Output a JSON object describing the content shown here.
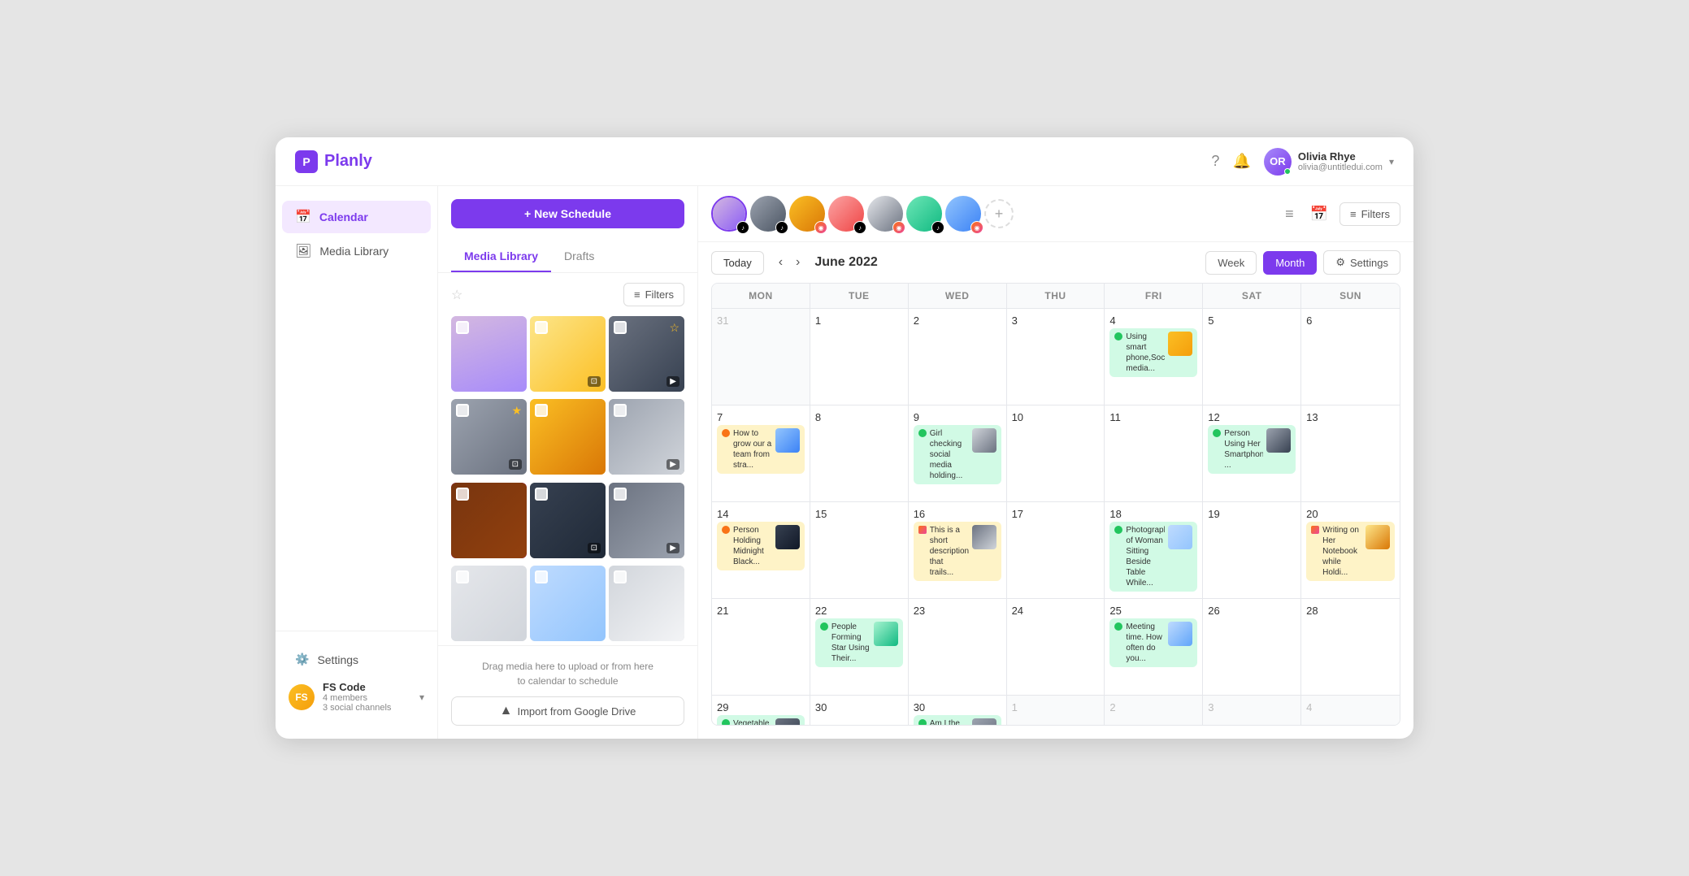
{
  "app": {
    "name": "Planly"
  },
  "topnav": {
    "user": {
      "name": "Olivia Rhye",
      "email": "olivia@untitledui.com",
      "initials": "OR"
    }
  },
  "sidebar": {
    "items": [
      {
        "id": "calendar",
        "label": "Calendar",
        "icon": "📅",
        "active": true
      },
      {
        "id": "media-library",
        "label": "Media Library",
        "icon": "🖼"
      }
    ],
    "settings_label": "Settings",
    "workspace": {
      "name": "FS Code",
      "members": "4 members",
      "channels": "3 social channels"
    }
  },
  "media_panel": {
    "new_schedule_label": "+ New Schedule",
    "tabs": [
      {
        "id": "media-library",
        "label": "Media Library",
        "active": true
      },
      {
        "id": "drafts",
        "label": "Drafts",
        "active": false
      }
    ],
    "filters_label": "Filters",
    "drag_text": "Drag media here to upload or from here\nto calendar to schedule",
    "import_label": "Import from Google Drive"
  },
  "calendar": {
    "title": "June 2022",
    "today_label": "Today",
    "week_label": "Week",
    "month_label": "Month",
    "settings_label": "Settings",
    "filters_label": "Filters",
    "days": [
      "MON",
      "TUE",
      "WED",
      "THU",
      "FRI",
      "SAT",
      "SUN"
    ],
    "weeks": [
      {
        "cells": [
          {
            "date": "31",
            "outside": true,
            "events": []
          },
          {
            "date": "1",
            "events": []
          },
          {
            "date": "2",
            "events": []
          },
          {
            "date": "3",
            "events": []
          },
          {
            "date": "4",
            "events": [
              {
                "type": "green",
                "text": "Using smart phone,Social media...",
                "hasThumb": true
              }
            ]
          },
          {
            "date": "5",
            "events": []
          },
          {
            "date": "6",
            "events": []
          }
        ]
      },
      {
        "cells": [
          {
            "date": "7",
            "events": [
              {
                "type": "orange",
                "text": "How to grow our a team from stra...",
                "hasThumb": true
              }
            ]
          },
          {
            "date": "8",
            "events": []
          },
          {
            "date": "9",
            "events": [
              {
                "type": "green",
                "text": "Girl checking social media holding...",
                "hasThumb": true
              }
            ]
          },
          {
            "date": "10",
            "events": []
          },
          {
            "date": "11",
            "events": []
          },
          {
            "date": "12",
            "events": [
              {
                "type": "green",
                "text": "Person Using Her Smartphone ...",
                "hasThumb": true
              }
            ]
          },
          {
            "date": "13",
            "events": []
          }
        ]
      },
      {
        "cells": [
          {
            "date": "14",
            "events": [
              {
                "type": "orange",
                "text": "Person Holding Midnight Black...",
                "hasThumb": true
              }
            ]
          },
          {
            "date": "15",
            "events": []
          },
          {
            "date": "16",
            "events": [
              {
                "type": "orange",
                "text": "This is a short description that trails...",
                "hasThumb": true
              }
            ]
          },
          {
            "date": "17",
            "events": []
          },
          {
            "date": "18",
            "events": [
              {
                "type": "green",
                "text": "Photography of Woman Sitting Beside Table While...",
                "hasThumb": true
              }
            ]
          },
          {
            "date": "19",
            "events": []
          },
          {
            "date": "20",
            "events": [
              {
                "type": "orange",
                "text": "Writing on Her Notebook while Holdi...",
                "hasThumb": true
              }
            ]
          }
        ]
      },
      {
        "cells": [
          {
            "date": "21",
            "events": []
          },
          {
            "date": "22",
            "events": [
              {
                "type": "green",
                "text": "People Forming Star Using Their...",
                "hasThumb": true
              }
            ]
          },
          {
            "date": "23",
            "events": []
          },
          {
            "date": "24",
            "events": []
          },
          {
            "date": "25",
            "events": [
              {
                "type": "green",
                "text": "Meeting time. How often do you...",
                "hasThumb": true
              }
            ]
          },
          {
            "date": "26",
            "events": []
          },
          {
            "date": "28",
            "events": []
          }
        ]
      },
      {
        "cells": [
          {
            "date": "29",
            "events": [
              {
                "type": "green",
                "text": "Vegetable Salad on Plate ...",
                "hasThumb": true
              }
            ]
          },
          {
            "date": "30",
            "events": []
          },
          {
            "date": "30",
            "events": [
              {
                "type": "green",
                "text": "Am I the only one who is obses...",
                "hasThumb": true
              }
            ]
          },
          {
            "date": "1",
            "outside": true,
            "events": []
          },
          {
            "date": "2",
            "outside": true,
            "events": []
          },
          {
            "date": "3",
            "outside": true,
            "events": []
          },
          {
            "date": "4",
            "outside": true,
            "events": []
          }
        ]
      }
    ]
  }
}
